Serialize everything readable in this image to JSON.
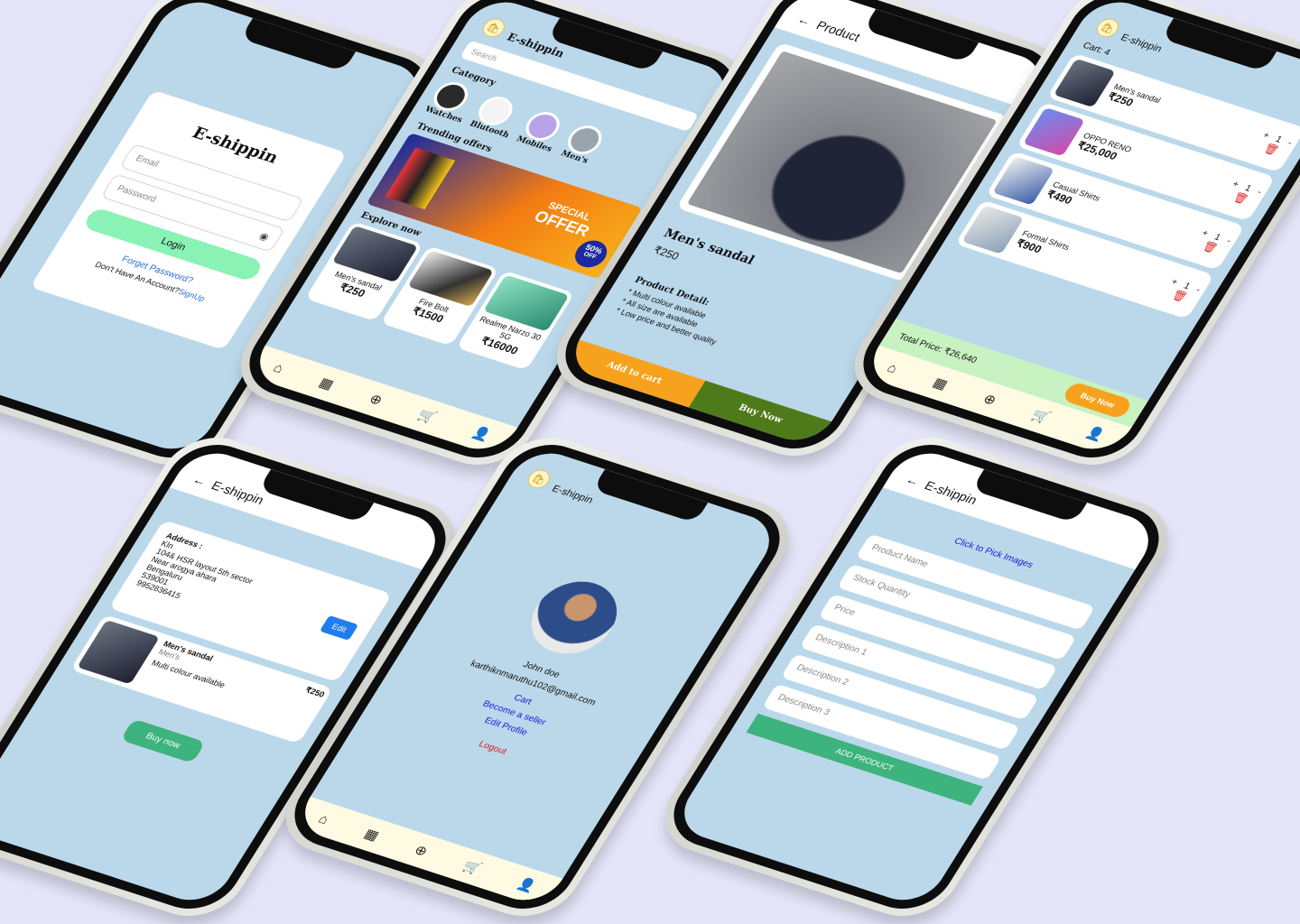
{
  "login": {
    "title": "E-shippin",
    "email_placeholder": "Email",
    "password_placeholder": "Password",
    "login_button": "Login",
    "forgot_link": "Forget Password?",
    "signup_prompt": "Don't Have An Account?",
    "signup_link": "SignUp"
  },
  "home": {
    "app_title": "E-shippin",
    "search_placeholder": "Search",
    "category_heading": "Category",
    "categories": [
      "Watches",
      "Blutooth",
      "Mobiles",
      "Men's"
    ],
    "trending_heading": "Trending offers",
    "offer_banner": {
      "line1": "SPECIAL",
      "line2": "OFFER",
      "badge_value": "50%",
      "badge_suffix": "OFF"
    },
    "explore_heading": "Explore now",
    "products": [
      {
        "name": "Men's sandal",
        "price": "₹250"
      },
      {
        "name": "Fire Bolt",
        "price": "₹1500"
      },
      {
        "name": "Realme Narzo 30 5G",
        "price": "₹16000"
      }
    ]
  },
  "product": {
    "app_title": "Product",
    "name": "Men's sandal",
    "price": "₹250",
    "detail_heading": "Product Detail:",
    "details": [
      "* Multi colour available",
      "* All size are available",
      "* Low price and better quality"
    ],
    "add_to_cart": "Add to cart",
    "buy_now": "Buy Now"
  },
  "cart": {
    "app_title": "E-shippin",
    "count_label": "Cart: 4",
    "items": [
      {
        "name": "Men's sandal",
        "price": "₹250",
        "qty": "1"
      },
      {
        "name": "OPPO RENO",
        "price": "₹25,000",
        "qty": "1"
      },
      {
        "name": "Casual Shirts",
        "price": "₹490",
        "qty": "1"
      },
      {
        "name": "Formal Shirts",
        "price": "₹900",
        "qty": "1"
      }
    ],
    "total_label": "Total Price: ₹26,640",
    "buy_now": "Buy Now"
  },
  "checkout": {
    "app_title": "E-shippin",
    "address_heading": "Address :",
    "address_lines": [
      "Kln",
      "104& HSR layout 5th sector",
      "Near arogya ahara",
      "Bengaluru",
      "539001",
      "9952836415"
    ],
    "edit_button": "Edit",
    "item": {
      "name": "Men's sandal",
      "category": "Men's",
      "desc": "Multi colour available",
      "price": "₹250"
    },
    "buy_now": "Buy now"
  },
  "profile": {
    "app_title": "E-shippin",
    "name": "John doe",
    "email": "karthiknmaruthu102@gmail.com",
    "links": [
      "Cart",
      "Become a seller",
      "Edit Profile"
    ],
    "logout": "Logout"
  },
  "add_product": {
    "app_title": "E-shippin",
    "pick_images": "Click to Pick Images",
    "fields": [
      "Product Name",
      "Stock Quantity",
      "Price",
      "Description 1",
      "Description 2",
      "Description 3"
    ],
    "submit": "ADD PRODUCT"
  },
  "nav_icons": [
    "home-icon",
    "grid-icon",
    "add-circle-icon",
    "cart-icon",
    "user-icon"
  ],
  "colors": {
    "background": "#e4e5f8",
    "screen": "#bad8ea",
    "login_green": "#8af2b4",
    "add_to_cart_orange": "#f6a21c",
    "buy_now_green": "#4f7a1a",
    "edit_blue": "#1e7df0",
    "primary_green": "#3db37e",
    "logout_red": "#e01b1b",
    "link_blue": "#1a1ad8"
  }
}
